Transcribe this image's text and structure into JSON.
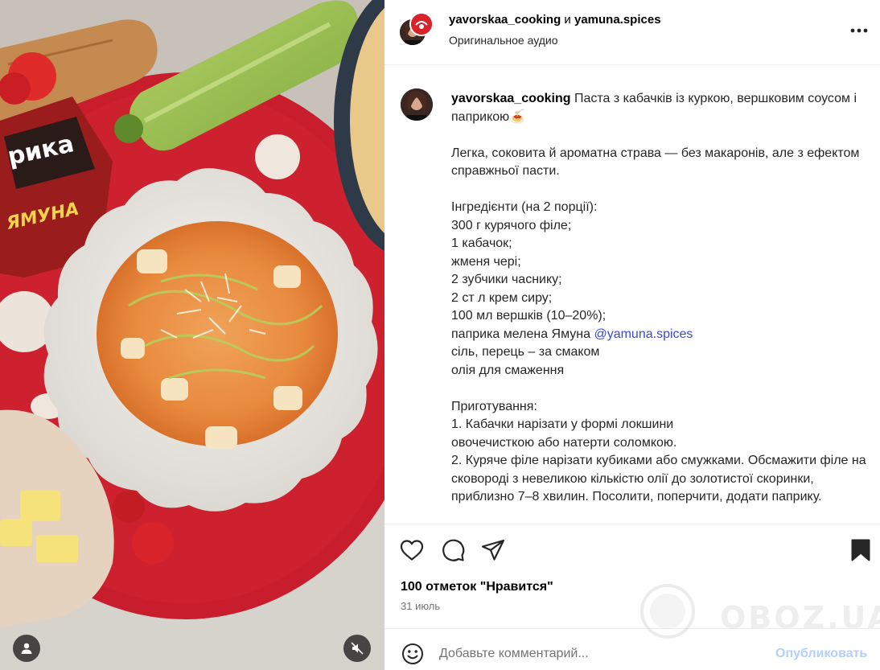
{
  "post": {
    "author_primary": "yavorskaa_cooking",
    "conjunction": "и",
    "author_secondary": "yamuna.spices",
    "audio_label": "Оригинальное аудио"
  },
  "caption": {
    "username": "yavorskaa_cooking",
    "title": "Паста з кабачків із куркою, вершковим соусом і паприкою🍝",
    "body_before_mention": "\n\nЛегка, соковита й ароматна страва — без макаронів, але з ефектом справжньої пасти.\n\nІнгредієнти (на 2 порції):\n300 г курячого філе;\n1 кабачок;\nжменя черi;\n2 зубчики часнику;\n2 ст л крем сиру;\n100 мл вершків (10–20%);\nпаприка мелена Ямуна ",
    "mention": "@yamuna.spices",
    "body_after_mention": "\nсіль, перець – за смаком\nолія для смаження\n\nПриготування:\n1. Кабачки нарізати у формі локшини\nовочечисткою або натерти соломкою.\n2. Куряче філе нарізати кубиками або смужками. Обсмажити філе на сковороді з невеликою кількістю олії до золотистої скоринки, приблизно 7–8 хвилин. Посолити, поперчити, додати паприку."
  },
  "stats": {
    "likes": "100 отметок \"Нравится\"",
    "date": "31 июль"
  },
  "comment": {
    "placeholder": "Добавьте комментарий...",
    "post_label": "Опубликовать"
  },
  "photo": {
    "package_text": "рика",
    "brand_text": "ЯМУНА"
  },
  "watermark": {
    "text": "OBOZ.UA"
  },
  "icons": {
    "like": "heart-icon",
    "comment": "comment-bubble-icon",
    "share": "paper-plane-icon",
    "save": "bookmark-icon",
    "more": "more-dots-icon",
    "emoji": "smiley-icon",
    "user_tag": "person-icon",
    "mute": "speaker-muted-icon"
  },
  "colors": {
    "accent_link": "#3949d8",
    "post_button_disabled": "#b4cffa",
    "secondary_text": "#737373"
  }
}
